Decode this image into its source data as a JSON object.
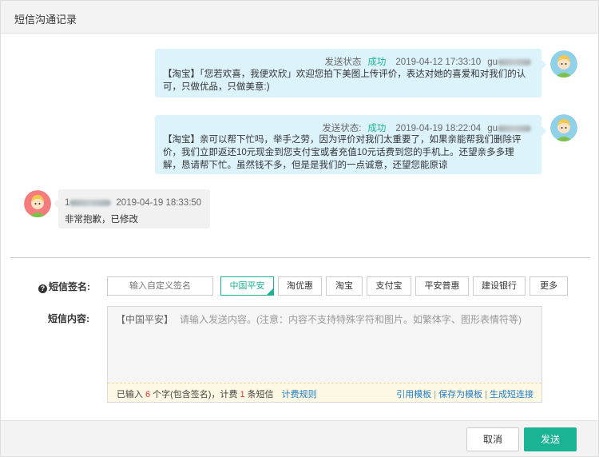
{
  "dialog": {
    "title": "短信沟通记录"
  },
  "messages": [
    {
      "status_label": "发送状态",
      "status": "成功",
      "time": "2019-04-12 17:33:10",
      "user": "gu",
      "text": "【淘宝】「您若欢喜，我便欢欣」欢迎您拍下美图上传评价，表达对她的喜爱和对我们的认可，只做优品，只做美意:)"
    },
    {
      "status_label": "发送状态:",
      "status": "成功",
      "time": "2019-04-19 18:22:04",
      "user": "gu",
      "text": "【淘宝】亲可以帮下忙吗，举手之劳，因为评价对我们太重要了，如果亲能帮我们删除评价，我们立即返还10元现金到您支付宝或者充值10元话费到您的手机上。还望亲多多理解，恳请帮下忙。虽然钱不多，但是是我们的一点诚意，还望您能原谅"
    }
  ],
  "reply": {
    "user": "1",
    "time": "2019-04-19 18:33:50",
    "text": "非常抱歉，已修改"
  },
  "form": {
    "signature_label": "短信签名:",
    "custom_signature_placeholder": "输入自定义签名",
    "signatures": [
      "中国平安",
      "淘优惠",
      "淘宝",
      "支付宝",
      "平安普惠",
      "建设银行",
      "更多"
    ],
    "content_label": "短信内容:",
    "content_prefix": "【中国平安】",
    "content_placeholder": "请输入发送内容。(注意：内容不支持特殊字符和图片。如繁体字、图形表情符等)",
    "counter": {
      "prefix": "已输入",
      "char_count": "6",
      "char_suffix": "个字(包含签名)，计费",
      "sms_count": "1",
      "sms_suffix": "条短信",
      "rules_link": "计费规则"
    },
    "actions": [
      "引用模板",
      "保存为模板",
      "生成短连接"
    ]
  },
  "footer": {
    "cancel": "取消",
    "send": "发送"
  },
  "colors": {
    "accent": "#1ab394",
    "bubble_out": "#dcf3fb",
    "bubble_in": "#f1f1f1",
    "link": "#1f7dc7"
  }
}
